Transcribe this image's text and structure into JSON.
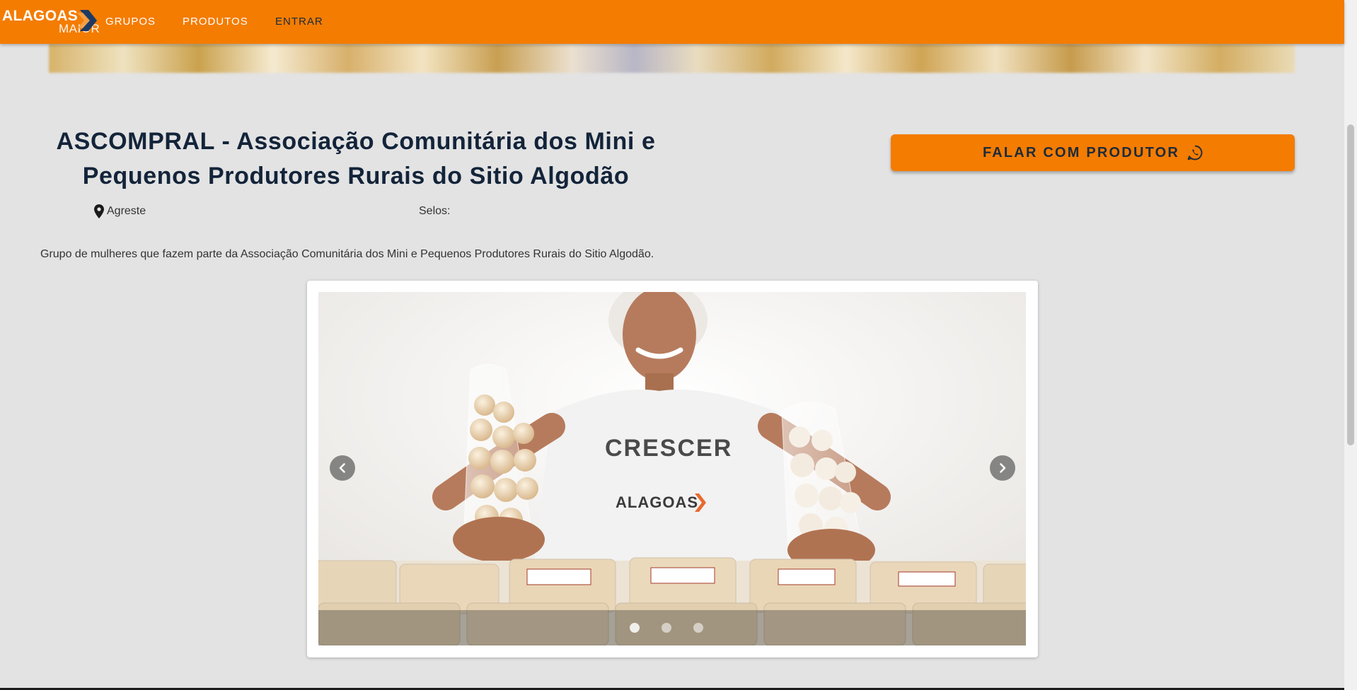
{
  "brand": {
    "logo_top": "ALAGOAS",
    "logo_bottom": "MAIOR",
    "primary_color": "#f47c00",
    "chevron_color": "#1d3a63"
  },
  "nav": {
    "items": [
      {
        "label": "GRUPOS"
      },
      {
        "label": "PRODUTOS"
      },
      {
        "label": "ENTRAR"
      }
    ]
  },
  "group": {
    "title": "ASCOMPRAL - Associação Comunitária dos Mini e Pequenos Produtores Rurais do Sitio Algodão",
    "location": "Agreste",
    "location_icon": "map-pin-icon",
    "selos_label": "Selos:",
    "description": "Grupo de mulheres que fazem parte da Associação Comunitária dos Mini e Pequenos Produtores Rurais do Sitio Algodão."
  },
  "cta": {
    "label": "FALAR COM PRODUTOR",
    "icon": "whatsapp-icon"
  },
  "carousel": {
    "slides": 3,
    "active_slide": 1,
    "prev_icon": "chevron-left-icon",
    "next_icon": "chevron-right-icon",
    "shirt_text_1": "CRESCER",
    "shirt_text_2": "ALAGOAS"
  }
}
